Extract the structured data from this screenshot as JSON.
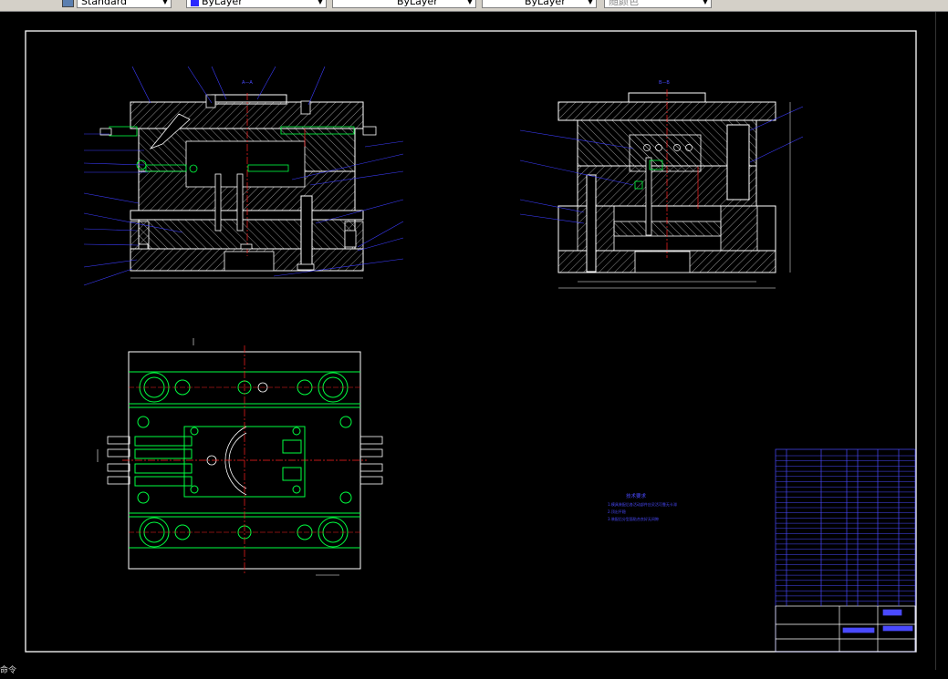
{
  "toolbar": {
    "text_style": "Standard",
    "layer": "ByLayer",
    "linetype": "ByLayer",
    "lineweight": "ByLayer",
    "plot_style": "随颜色"
  },
  "drawing": {
    "section_label_aa": "A—A",
    "section_label_bb": "B—B",
    "tech_title": "技术要求",
    "tech_lines": [
      "1.模具装配后各活动部件应灵活可靠无卡滞",
      "2.顶出平稳",
      "3.装配后分型面贴合良好无间隙"
    ]
  },
  "status": {
    "fragment": "命令"
  },
  "colors": {
    "background": "#000000",
    "frame": "#ffffff",
    "outline": "#ffffff",
    "leader": "#3c3cff",
    "center": "#ff2020",
    "part": "#00ff40",
    "title_block": "#4a4aff"
  }
}
